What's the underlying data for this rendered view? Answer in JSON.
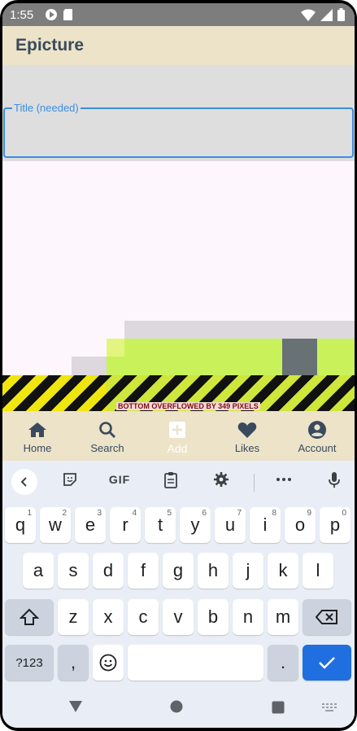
{
  "status_bar": {
    "time": "1:55",
    "left_icons": [
      "play-protect-icon",
      "sd-card-icon"
    ],
    "right_icons": [
      "wifi-icon",
      "signal-icon",
      "battery-icon"
    ]
  },
  "app_bar": {
    "title": "Epicture"
  },
  "form": {
    "title_field": {
      "label": "Title (needed)",
      "value": ""
    }
  },
  "overflow_message": "BOTTOM OVERFLOWED BY 349 PIXELS",
  "bottom_nav": {
    "items": [
      {
        "label": "Home",
        "icon": "home-icon"
      },
      {
        "label": "Search",
        "icon": "search-icon"
      },
      {
        "label": "Add",
        "icon": "add-box-icon"
      },
      {
        "label": "Likes",
        "icon": "heart-icon"
      },
      {
        "label": "Account",
        "icon": "account-circle-icon"
      }
    ]
  },
  "keyboard": {
    "toolbar": [
      "back-chevron-icon",
      "sticker-icon",
      "GIF",
      "clipboard-icon",
      "settings-icon",
      "more-icon",
      "mic-icon"
    ],
    "rows": [
      [
        [
          "q",
          "1"
        ],
        [
          "w",
          "2"
        ],
        [
          "e",
          "3"
        ],
        [
          "r",
          "4"
        ],
        [
          "t",
          "5"
        ],
        [
          "y",
          "6"
        ],
        [
          "u",
          "7"
        ],
        [
          "i",
          "8"
        ],
        [
          "o",
          "9"
        ],
        [
          "p",
          "0"
        ]
      ],
      [
        [
          "a"
        ],
        [
          "s"
        ],
        [
          "d"
        ],
        [
          "f"
        ],
        [
          "g"
        ],
        [
          "h"
        ],
        [
          "j"
        ],
        [
          "k"
        ],
        [
          "l"
        ]
      ],
      [
        [
          "z"
        ],
        [
          "x"
        ],
        [
          "c"
        ],
        [
          "v"
        ],
        [
          "b"
        ],
        [
          "n"
        ],
        [
          "m"
        ]
      ]
    ],
    "symbols_label": "?123",
    "comma": ",",
    "period": "."
  },
  "colors": {
    "app_bar": "#ece3c8",
    "accent": "#3a8ee2",
    "lime": "#c9f25a",
    "enter_key": "#1f6fe0"
  }
}
